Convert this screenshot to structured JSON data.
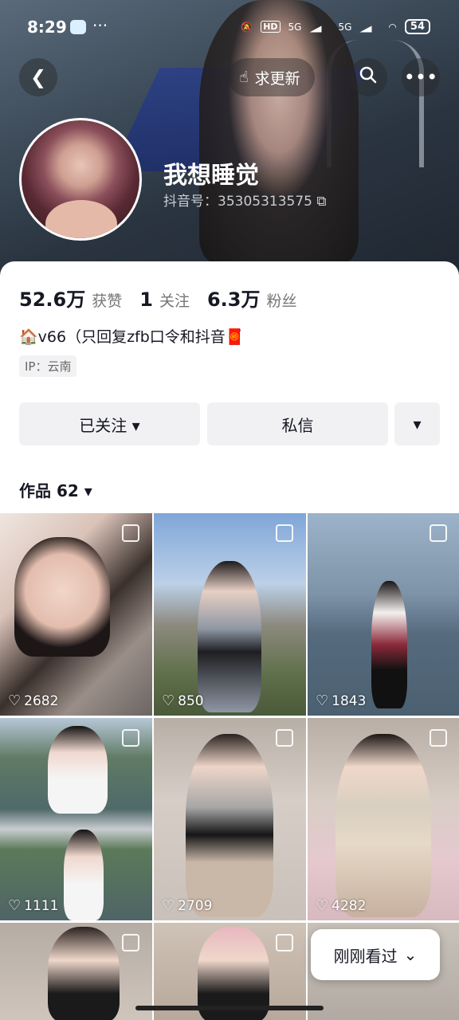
{
  "status_bar": {
    "time": "8:29",
    "dots": "···",
    "hd_label": "HD",
    "net_1": "5G",
    "net_2": "5G",
    "battery": "54"
  },
  "top_bar": {
    "back_icon": "chevron-left-icon",
    "update_label": "求更新",
    "update_icon": "hand-pointer-icon",
    "search_icon": "search-icon",
    "more_icon": "more-icon"
  },
  "profile": {
    "nickname": "我想睡觉",
    "douyin_id": "抖音号：35305313575",
    "stats": {
      "likes_value": "52.6万",
      "likes_label": "获赞",
      "following_value": "1",
      "following_label": "关注",
      "fans_value": "6.3万",
      "fans_label": "粉丝"
    },
    "bio": "🏠v66（只回复zfb口令和抖音🧧",
    "ip": "IP：云南"
  },
  "actions": {
    "follow_label": "已关注 ▾",
    "dm_label": "私信",
    "dropdown_label": "▾"
  },
  "works": {
    "tab_label": "作品 62 ▾",
    "items": [
      {
        "likes": "2682"
      },
      {
        "likes": "850"
      },
      {
        "likes": "1843"
      },
      {
        "likes": "1111"
      },
      {
        "likes": "2709"
      },
      {
        "likes": "4282"
      },
      {
        "likes": ""
      },
      {
        "likes": ""
      },
      {
        "likes": ""
      }
    ]
  },
  "floating": {
    "recent_label": "刚刚看过",
    "recent_icon": "double-chevron-down-icon"
  }
}
